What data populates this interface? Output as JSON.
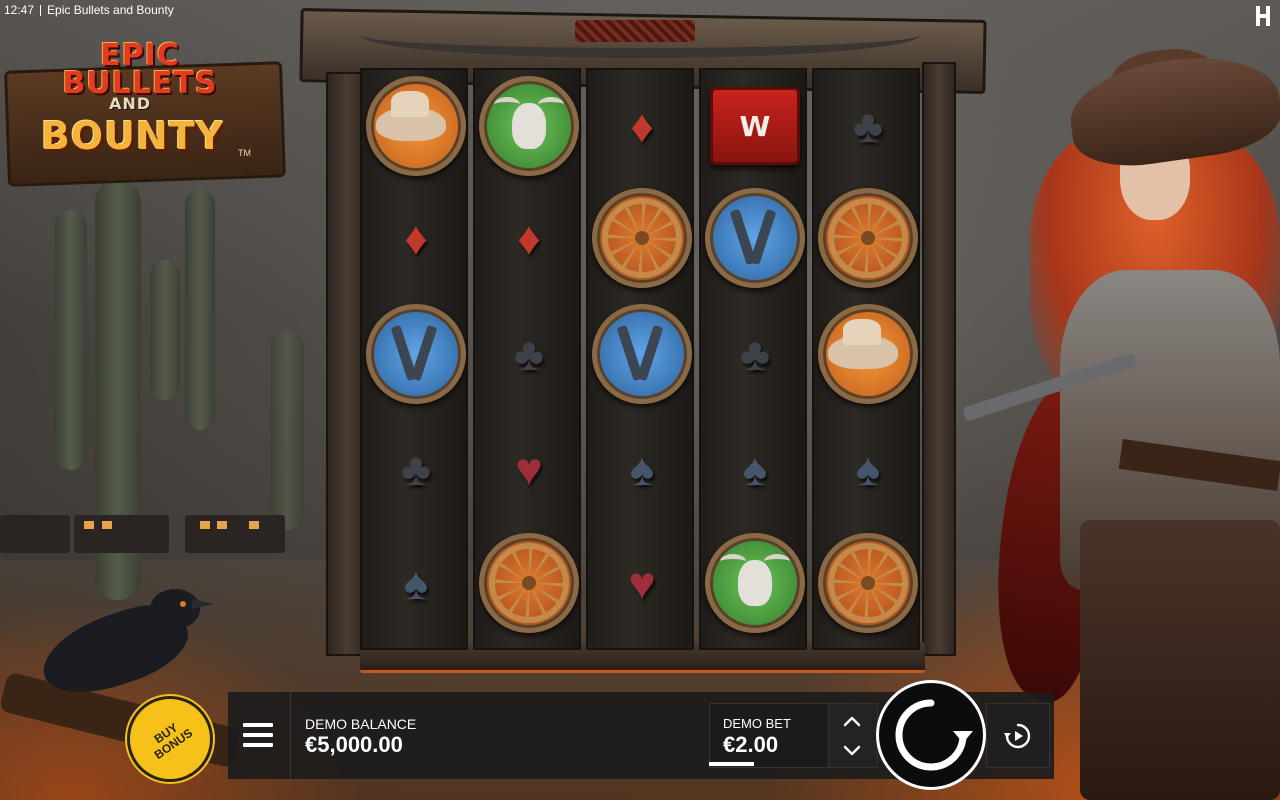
{
  "status_bar": {
    "time": "12:47",
    "app_title": "Epic Bullets and Bounty"
  },
  "logo": {
    "line1": "EPIC",
    "line2": "BULLETS",
    "line3": "AND",
    "line4": "BOUNTY",
    "tm": "TM"
  },
  "colors": {
    "buy_bonus": "#f6c21a",
    "control_bar": "#1c1c1c",
    "accent_red": "#c0392b"
  },
  "reels": [
    [
      "hat",
      "diamond",
      "guns",
      "club",
      "spade"
    ],
    [
      "skull",
      "diamond",
      "club",
      "heart",
      "wheel"
    ],
    [
      "diamond",
      "wheel",
      "guns",
      "spade",
      "heart"
    ],
    [
      "dynamite",
      "guns",
      "club",
      "spade",
      "skull"
    ],
    [
      "club",
      "wheel",
      "hat",
      "spade",
      "wheel"
    ]
  ],
  "dynamite_label": "W",
  "controls": {
    "buy_bonus_label": "BUY BONUS",
    "balance_label": "DEMO BALANCE",
    "balance_value": "€5,000.00",
    "bet_label": "DEMO BET",
    "bet_value": "€2.00",
    "bet_up_icon": "chevron-up-icon",
    "bet_down_icon": "chevron-down-icon",
    "spin_icon": "spin-refresh-icon",
    "autoplay_icon": "autoplay-icon",
    "menu_icon": "hamburger-menu-icon"
  }
}
